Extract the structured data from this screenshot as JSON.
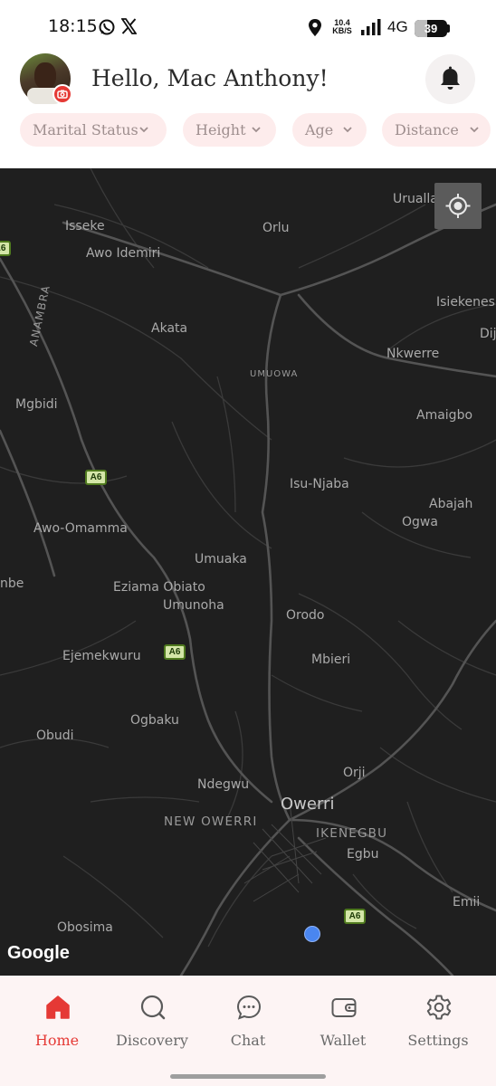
{
  "status_bar": {
    "time": "18:15",
    "speed_value": "10.4",
    "speed_unit": "KB/S",
    "network": "4G",
    "battery_level": "39",
    "battery_fraction": 0.39,
    "icons": [
      "whatsapp-icon",
      "x-icon",
      "location-icon",
      "signal-icon",
      "battery-icon"
    ]
  },
  "header": {
    "greeting": "Hello, Mac Anthony!",
    "avatar_icon": "avatar",
    "badge_icon": "camera-icon",
    "bell_icon": "bell-icon"
  },
  "filters": [
    {
      "label": "Marital Status"
    },
    {
      "label": "Height"
    },
    {
      "label": "Age"
    },
    {
      "label": "Distance"
    }
  ],
  "map": {
    "locate_icon": "crosshair-icon",
    "attribution": "Google",
    "state_label": "ANAMBRA",
    "places": {
      "isseke": "Isseke",
      "awo_idemiri": "Awo Idemiri",
      "orlu": "Orlu",
      "urualla": "Urualla",
      "isiekenes": "Isiekenes",
      "dij": "Dij",
      "akata": "Akata",
      "umuowa": "UMUOWA",
      "nkwerre": "Nkwerre",
      "mgbidi": "Mgbidi",
      "amaigbo": "Amaigbo",
      "isu_njaba": "Isu-Njaba",
      "abajah": "Abajah",
      "ogwa": "Ogwa",
      "awo_omamma": "Awo-Omamma",
      "umuaka": "Umuaka",
      "nbe": "nbe",
      "eziama_obiato": "Eziama Obiato",
      "umunoha": "Umunoha",
      "orodo": "Orodo",
      "ejemekwuru": "Ejemekwuru",
      "mbieri": "Mbieri",
      "ogbaku": "Ogbaku",
      "obudi": "Obudi",
      "orji": "Orji",
      "ndegwu": "Ndegwu",
      "owerri": "Owerri",
      "new_owerri": "NEW OWERRI",
      "ikenegbu": "IKENEGBU",
      "egbu": "Egbu",
      "emii": "Emii",
      "obosima": "Obosima"
    },
    "highway": "A6"
  },
  "nav": [
    {
      "label": "Home",
      "icon": "home-icon",
      "active": true
    },
    {
      "label": "Discovery",
      "icon": "discovery-icon",
      "active": false
    },
    {
      "label": "Chat",
      "icon": "chat-icon",
      "active": false
    },
    {
      "label": "Wallet",
      "icon": "wallet-icon",
      "active": false
    },
    {
      "label": "Settings",
      "icon": "settings-icon",
      "active": false
    }
  ],
  "colors": {
    "accent": "#e53935",
    "chip_bg": "#fdecec",
    "map_bg": "#1f1f1f",
    "nav_bg": "#fdf4f4"
  }
}
